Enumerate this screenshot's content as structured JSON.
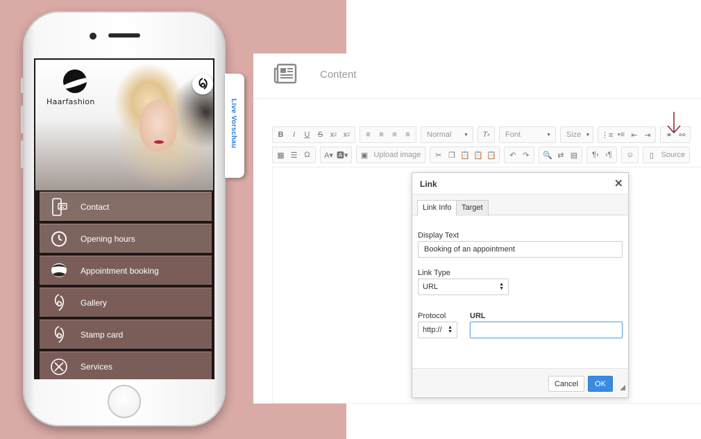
{
  "phone": {
    "brand_name": "Haarfashion",
    "live_preview_label": "Live Vorschau",
    "menu": [
      {
        "label": "Contact",
        "icon": "phone-card-icon"
      },
      {
        "label": "Opening hours",
        "icon": "clock-icon"
      },
      {
        "label": "Appointment booking",
        "icon": "man-face-icon"
      },
      {
        "label": "Gallery",
        "icon": "hair-swirl-icon"
      },
      {
        "label": "Stamp card",
        "icon": "hair-swirl-icon"
      },
      {
        "label": "Services",
        "icon": "scissors-comb-icon"
      }
    ]
  },
  "editor": {
    "section_title": "Content",
    "toolbar": {
      "style_label": "Normal",
      "font_label": "Font",
      "size_label": "Size",
      "upload_image_label": "Upload image",
      "source_label": "Source"
    }
  },
  "link_dialog": {
    "title": "Link",
    "tabs": [
      "Link Info",
      "Target"
    ],
    "display_text_label": "Display Text",
    "display_text_value": "Booking of an appointment",
    "link_type_label": "Link Type",
    "link_type_value": "URL",
    "protocol_label": "Protocol",
    "protocol_value": "http://",
    "url_label": "URL",
    "url_value": "",
    "cancel_label": "Cancel",
    "ok_label": "OK"
  },
  "colors": {
    "background_pink": "#d9aaa6",
    "accent_blue": "#3a8be0",
    "arrow_red": "#8b2232"
  }
}
